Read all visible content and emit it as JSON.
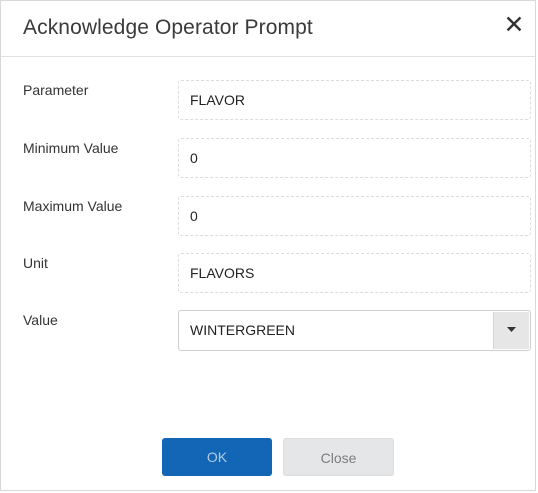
{
  "dialog": {
    "title": "Acknowledge Operator Prompt",
    "close_glyph": "✕"
  },
  "fields": {
    "parameter": {
      "label": "Parameter",
      "value": "FLAVOR"
    },
    "minimum_value": {
      "label": "Minimum Value",
      "value": "0"
    },
    "maximum_value": {
      "label": "Maximum Value",
      "value": "0"
    },
    "unit": {
      "label": "Unit",
      "value": "FLAVORS"
    },
    "value": {
      "label": "Value",
      "selected": "WINTERGREEN"
    }
  },
  "buttons": {
    "ok_label": "OK",
    "close_label": "Close"
  },
  "colors": {
    "primary_button": "#1366b5",
    "secondary_button": "#e4e6e8"
  },
  "icons": {
    "close": "close-icon",
    "dropdown": "chevron-down-icon"
  }
}
